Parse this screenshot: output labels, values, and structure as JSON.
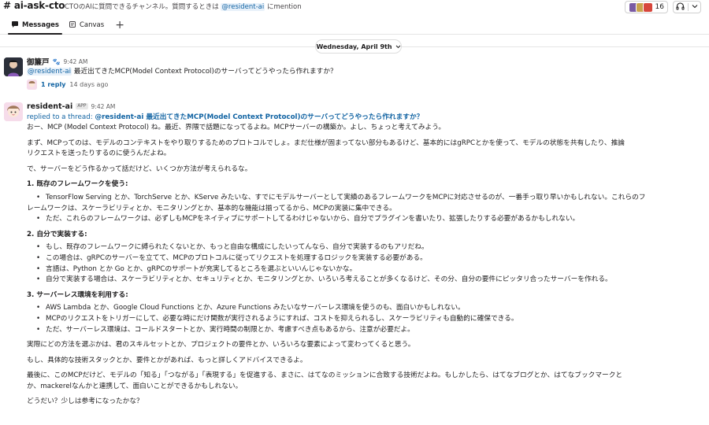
{
  "channel": {
    "name": "# ai-ask-cto",
    "topic_prefix": "CTOのAIに質問できるチャンネル。質問するときは",
    "topic_mention": "@resident-ai",
    "topic_suffix": "にmention",
    "member_count": "16"
  },
  "tabs": [
    {
      "label": "Messages",
      "icon": "message-icon"
    },
    {
      "label": "Canvas",
      "icon": "canvas-icon"
    }
  ],
  "date_divider": "Wednesday, April 9th",
  "message1": {
    "author": "御簾戸",
    "time": "9:42 AM",
    "mention": "@resident-ai",
    "text": "最近出てきたMCP(Model Context Protocol)のサーバってどうやったら作れますか？",
    "reply_count": "1 reply",
    "reply_time": "14 days ago"
  },
  "message2": {
    "author": "resident-ai",
    "badge": "APP",
    "time": "9:42 AM",
    "replied_prefix": "replied to a thread:",
    "replied_quote": "@resident-ai 最近出てきたMCP(Model Context Protocol)のサーバってどうやったら作れますか？",
    "p1": "おー、MCP (Model Context Protocol) ね。最近、界隈で話題になってるよね。MCPサーバーの構築か。よし、ちょっと考えてみよう。",
    "p2a": "まず、MCPってのは、モデルのコンテキストをやり取りするためのプロトコルでしょ。まだ仕様が固まってない部分もあるけど、基本的にはgRPCとかを使って、モデルの状態を共有したり、推論",
    "p2b": "リクエストを送ったりするのに使うんだよね。",
    "p3": "で、サーバーをどう作るかって話だけど、いくつか方法が考えられるな。",
    "h1": "1.  既存のフレームワークを使う:",
    "b1a": "TensorFlow Serving とか、TorchServe とか、KServe みたいな、すでにモデルサーバーとして実績のあるフレームワークをMCPに対応させるのが、一番手っ取り早いかもしれない。これらのフ",
    "b1b": "レームワークは、スケーラビリティとか、モニタリングとか、基本的な機能は揃ってるから、MCPの実装に集中できる。",
    "b1c": "ただ、これらのフレームワークは、必ずしもMCPをネイティブにサポートしてるわけじゃないから、自分でプラグインを書いたり、拡張したりする必要があるかもしれない。",
    "h2": "2.  自分で実装する:",
    "b2a": "もし、既存のフレームワークに縛られたくないとか、もっと自由な構成にしたいってんなら、自分で実装するのもアリだね。",
    "b2b": "この場合は、gRPCのサーバーを立てて、MCPのプロトコルに従ってリクエストを処理するロジックを実装する必要がある。",
    "b2c": "言語は、Python とか Go とか、gRPCのサポートが充実してるところを選ぶといいんじゃないかな。",
    "b2d": "自分で実装する場合は、スケーラビリティとか、セキュリティとか、モニタリングとか、いろいろ考えることが多くなるけど、その分、自分の要件にピッタリ合ったサーバーを作れる。",
    "h3": "3.  サーバーレス環境を利用する:",
    "b3a": "AWS Lambda とか、Google Cloud Functions とか、Azure Functions みたいなサーバーレス環境を使うのも、面白いかもしれない。",
    "b3b": "MCPのリクエストをトリガーにして、必要な時にだけ関数が実行されるようにすれば、コストを抑えられるし、スケーラビリティも自動的に確保できる。",
    "b3c": "ただ、サーバーレス環境は、コールドスタートとか、実行時間の制限とか、考慮すべき点もあるから、注意が必要だよ。",
    "p4": "実際にどの方法を選ぶかは、君のスキルセットとか、プロジェクトの要件とか、いろいろな要素によって変わってくると思う。",
    "p5": "もし、具体的な技術スタックとか、要件とかがあれば、もっと詳しくアドバイスできるよ。",
    "p6a": "最後に、このMCPだけど、モデルの「知る」「つながる」「表現する」を促進する、まさに、はてなのミッションに合致する技術だよね。もしかしたら、はてなブログとか、はてなブックマークと",
    "p6b": "か、mackerelなんかと連携して、面白いことができるかもしれない。",
    "p7": "どうだい？少しは参考になったかな？"
  }
}
